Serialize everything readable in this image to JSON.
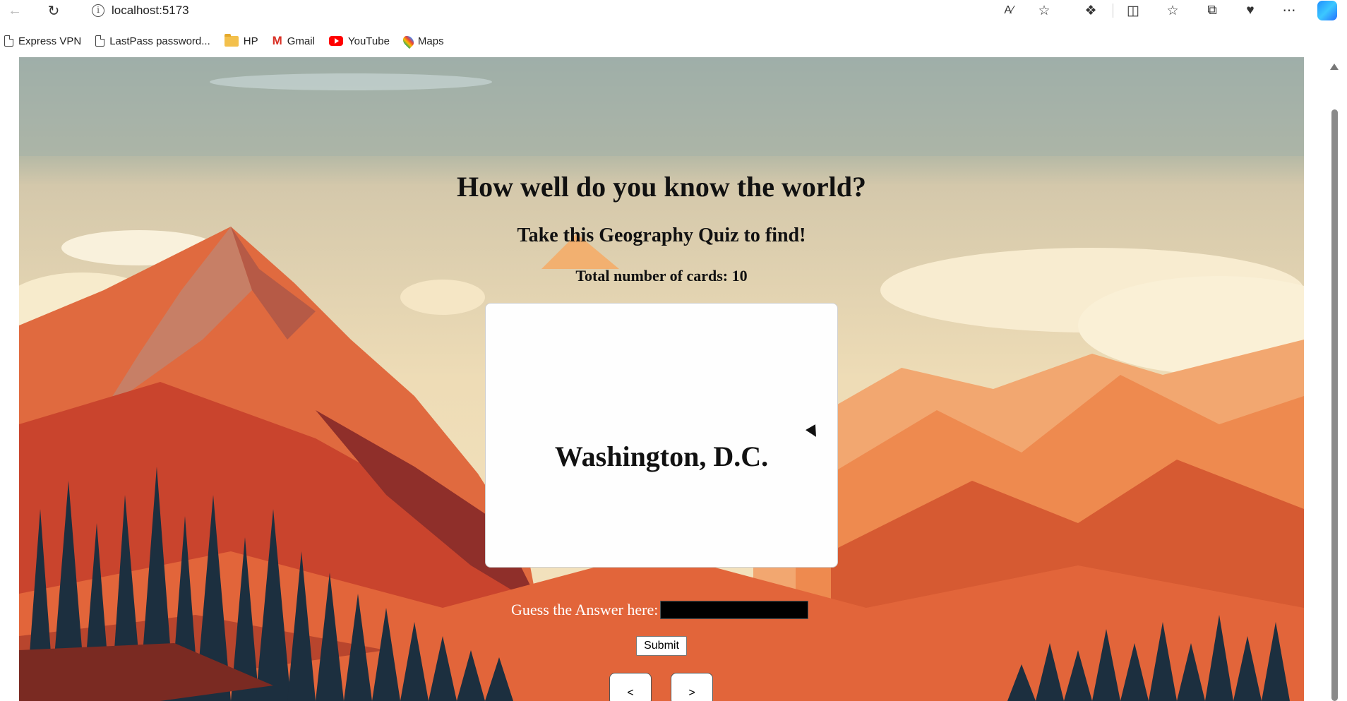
{
  "browser": {
    "url": "localhost:5173",
    "bookmarks": [
      {
        "label": "Express VPN",
        "icon": "document-icon"
      },
      {
        "label": "LastPass password...",
        "icon": "document-icon"
      },
      {
        "label": "HP",
        "icon": "folder-icon"
      },
      {
        "label": "Gmail",
        "icon": "gmail-icon"
      },
      {
        "label": "YouTube",
        "icon": "youtube-icon"
      },
      {
        "label": "Maps",
        "icon": "maps-icon"
      }
    ],
    "toolbar_icons": [
      "back-icon",
      "reload-icon",
      "info-icon",
      "read-aloud-icon",
      "favorite-star-icon",
      "extensions-icon",
      "split-screen-icon",
      "favorites-icon",
      "collections-icon",
      "browser-essentials-icon",
      "more-icon",
      "copilot-icon"
    ]
  },
  "quiz": {
    "title": "How well do you know the world?",
    "subtitle": "Take this Geography Quiz to find!",
    "count_text": "Total number of cards: 10",
    "card_text": "Washington, D.C.",
    "guess_label": "Guess the Answer here:",
    "guess_value": "",
    "submit_label": "Submit",
    "prev_label": "<",
    "next_label": ">"
  },
  "colors": {
    "sky": "#a9b6a8",
    "mountain": "#d9582f",
    "trees": "#1c2f3f"
  }
}
